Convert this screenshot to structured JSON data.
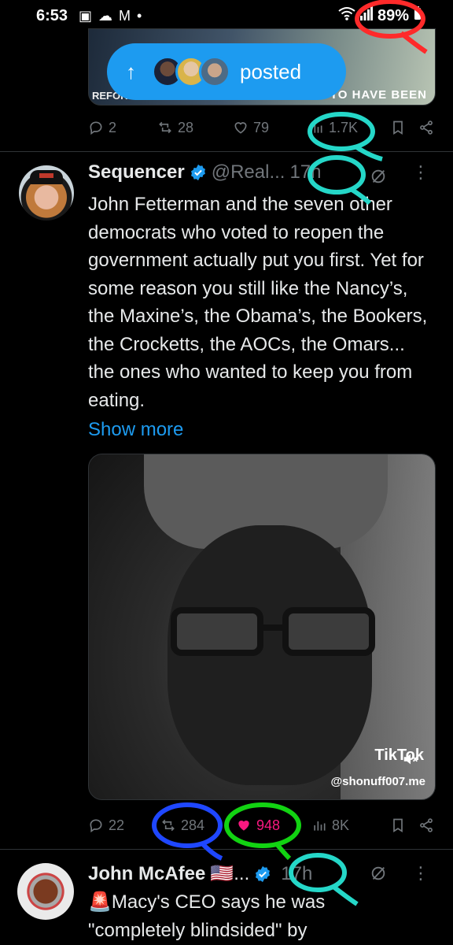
{
  "status_bar": {
    "time": "6:53",
    "battery": "89%"
  },
  "top_post": {
    "media_caption": "S TO HAVE BEEN",
    "media_caption_left": "REFOR",
    "posted_label": "posted",
    "actions": {
      "replies": "2",
      "reposts": "28",
      "likes": "79",
      "views": "1.7K"
    }
  },
  "tweet": {
    "name": "Sequencer",
    "handle": "@Real...",
    "time": "17h",
    "text": "John Fetterman and the seven other democrats who voted to reopen the government actually put you first. Yet for some reason you still like the Nancy’s, the Maxine’s, the Obama’s, the Bookers, the Crocketts, the AOCs, the Omars... the ones who wanted to keep you from eating.",
    "show_more": "Show more",
    "video": {
      "brand": "TikTok",
      "handle": "@shonuff007.me"
    },
    "actions": {
      "replies": "22",
      "reposts": "284",
      "likes": "948",
      "views": "8K"
    }
  },
  "next_tweet": {
    "name": "John McAfee",
    "flag": "🇺🇸...",
    "time": "17h",
    "text_line1": "🚨Macy's CEO says he was",
    "text_line2": "\"completely blindsided\" by"
  },
  "colors": {
    "accent": "#1d9bf0",
    "like": "#f91880",
    "muted": "#71767b",
    "annotation_red": "#ff2a2a",
    "annotation_teal": "#25d7c8",
    "annotation_blue": "#1f47ff",
    "annotation_green": "#12d312"
  }
}
